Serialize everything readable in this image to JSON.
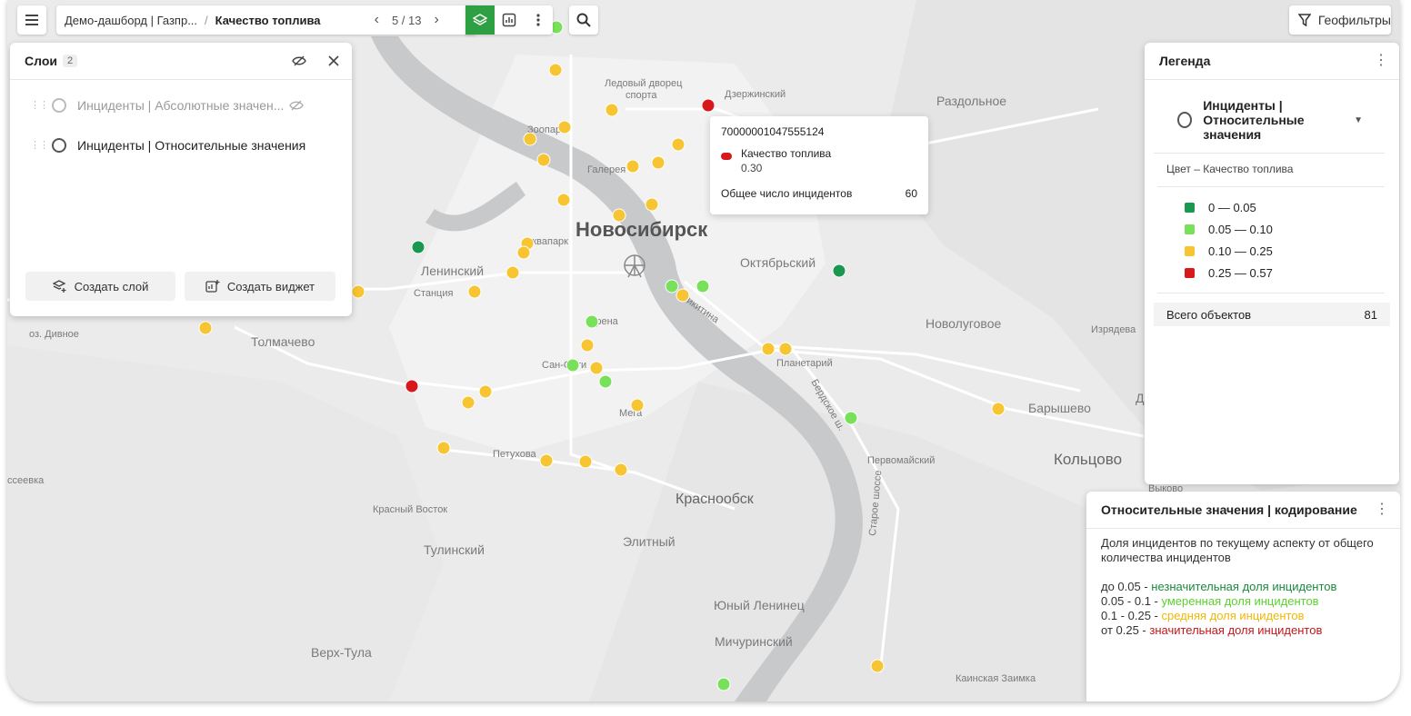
{
  "topbar": {
    "breadcrumb_dashboard": "Демо-дашборд | Газпр...",
    "breadcrumb_sep": "/",
    "breadcrumb_page": "Качество топлива",
    "pager": "5 / 13",
    "geofilters_label": "Геофильтры",
    "accent_color": "#2ea043"
  },
  "layers_panel": {
    "title": "Слои",
    "count": "2",
    "layers": [
      {
        "label": "Инциденты | Абсолютные значен...",
        "visible": false
      },
      {
        "label": "Инциденты | Относительные значения",
        "visible": true
      }
    ],
    "create_layer": "Создать слой",
    "create_widget": "Создать виджет"
  },
  "tooltip": {
    "id": "70000001047555124",
    "metric_name": "Качество топлива",
    "metric_value": "0.30",
    "total_label": "Общее число инцидентов",
    "total_value": "60"
  },
  "legend": {
    "title": "Легенда",
    "layer_name": "Инциденты | Относительные значения",
    "subtitle": "Цвет – Качество топлива",
    "items": [
      {
        "label": "0 — 0.05",
        "color": "#1a9850"
      },
      {
        "label": "0.05 — 0.10",
        "color": "#78e05a"
      },
      {
        "label": "0.10 — 0.25",
        "color": "#f6c531"
      },
      {
        "label": "0.25 — 0.57",
        "color": "#d7191c"
      }
    ],
    "total_label": "Всего объектов",
    "total_value": "81"
  },
  "coding": {
    "title": "Относительные значения | кодирование",
    "description": "Доля инцидентов по текущему аспекту от общего количества инцидентов",
    "lines": [
      {
        "range": "до 0.05",
        "text": "незначительная доля инцидентов"
      },
      {
        "range": "0.05 - 0.1",
        "text": "умеренная доля инцидентов"
      },
      {
        "range": "0.1 - 0.25",
        "text": "средняя доля инцидентов"
      },
      {
        "range": "от 0.25",
        "text": "значительная доля инцидентов"
      }
    ]
  },
  "map": {
    "labels": [
      "Новосибирск",
      "Дзержинский",
      "Раздольное",
      "Ледовый дворец",
      "спорта",
      "Зоопарк",
      "Галерея",
      "Аквапарк",
      "Ленинский",
      "Станция",
      "Толмачево",
      "оз. Дивное",
      "Октябрьский",
      "Новолуговое",
      "Изрядева",
      "Сан-Сити",
      "Арена",
      "Мега",
      "Планетарий",
      "Петухова",
      "Бердское ш.",
      "Первомайский",
      "Барышево",
      "Кольцово",
      "Краснообск",
      "Красный Восток",
      "Тулинский",
      "Элитный",
      "Юный Ленинец",
      "Мичуринский",
      "Верх-Тула",
      "Каинская Заимка",
      "Ду",
      "Выково",
      "Старое шоссе",
      "ссеевка",
      "Никитина"
    ]
  }
}
